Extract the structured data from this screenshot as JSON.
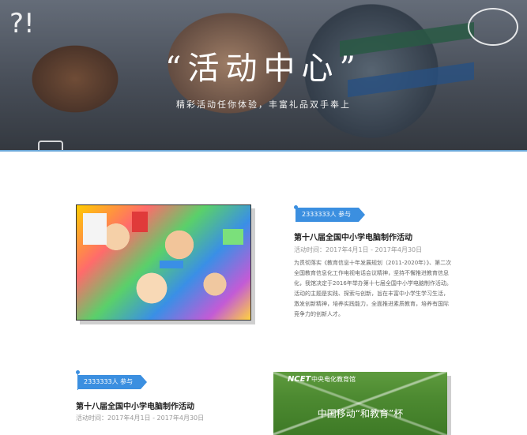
{
  "hero": {
    "title": "“活动中心”",
    "subtitle": "精彩活动任你体验，丰富礼品双手奉上",
    "doodle": "?!"
  },
  "activities": [
    {
      "participants": "2333333人 参与",
      "title": "第十八届全国中小学电脑制作活动",
      "time": "活动时间：2017年4月1日 - 2017年4月30日",
      "description": "为贯彻落实《教育信息十年发展规划（2011-2020年）》、第二次全国教育信息化工作电视电话会议精神，坚持不懈推进教育信息化，我馆决定于2016年举办第十七届全国中小学电脑制作活动。活动的主题是实践、探索与创新，旨在丰富中小学生学习生活，激发创新精神，培养实践能力，全面推进素质教育，培养有国际竞争力的创新人才。"
    },
    {
      "participants": "2333333人 参与",
      "title": "第十八届全国中小学电脑制作活动",
      "time": "活动时间：2017年4月1日 - 2017年4月30日",
      "image_logo": "NCET",
      "image_logo_cn": "中央电化教育馆",
      "image_caption": "中国移动“和教育”杯"
    }
  ],
  "colors": {
    "accent": "#3b8fe0",
    "hero_border": "#6aa7d8"
  }
}
